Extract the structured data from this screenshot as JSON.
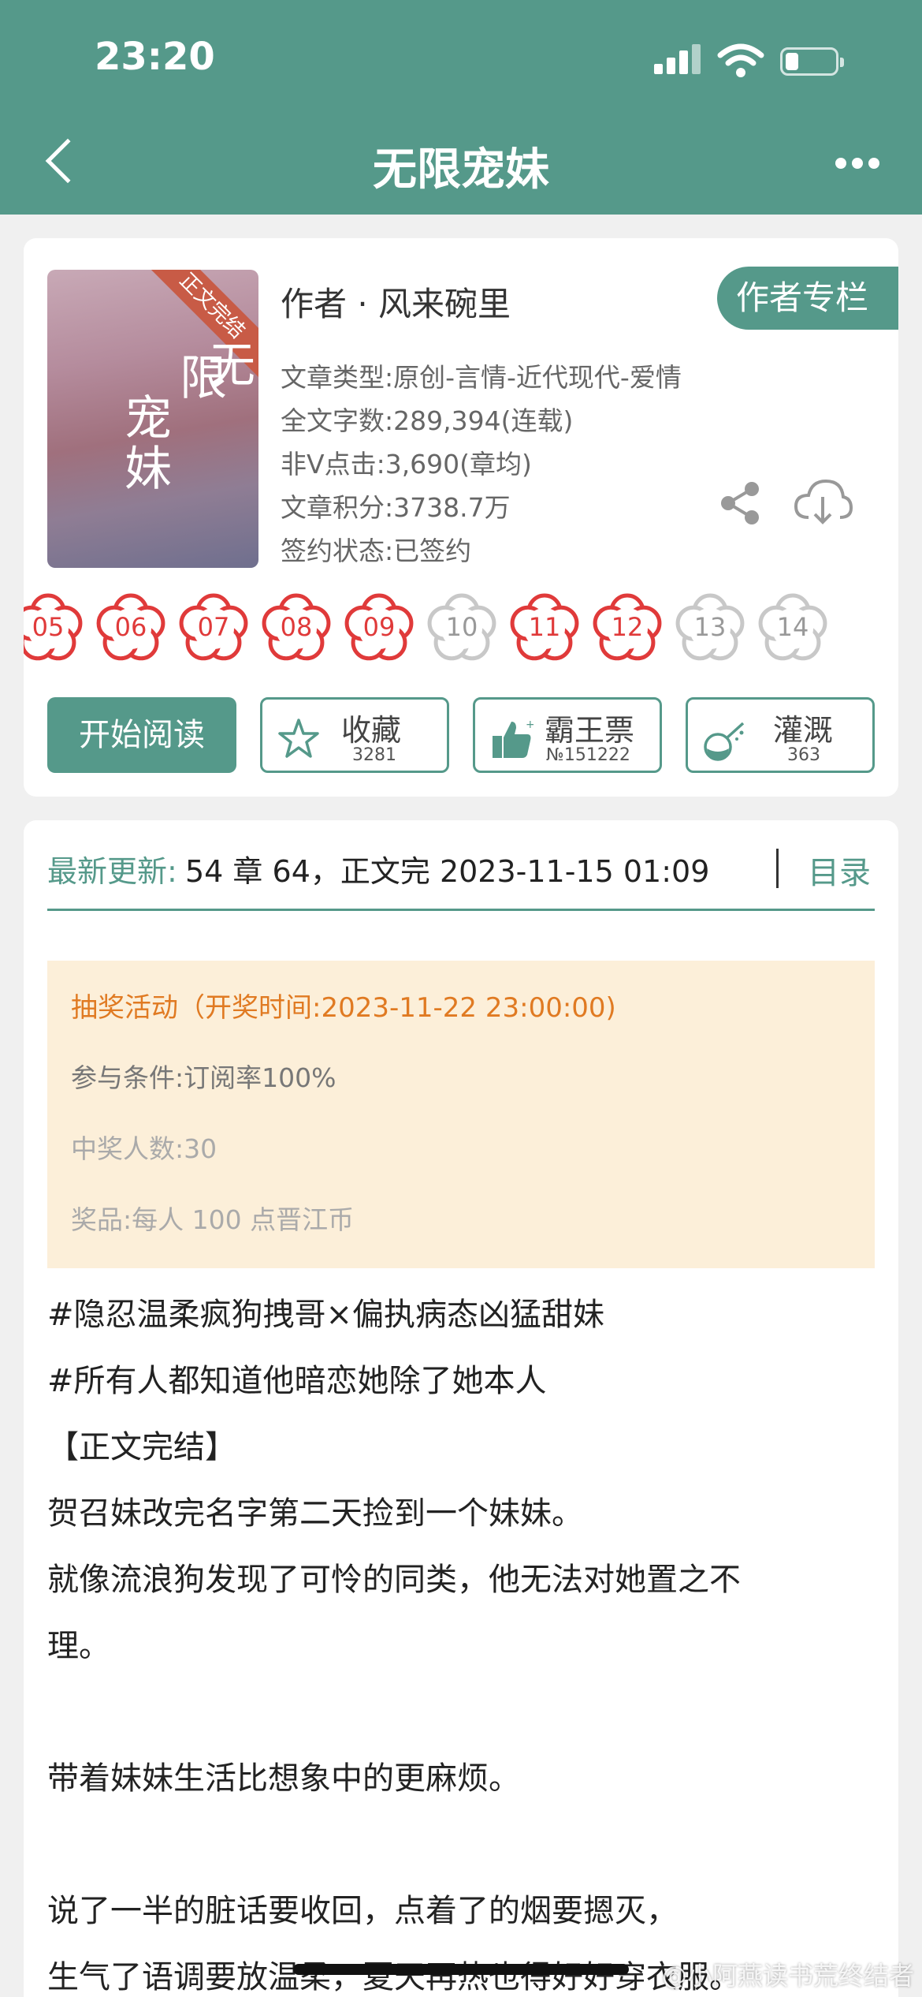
{
  "status_bar": {
    "time": "23:20"
  },
  "nav": {
    "title": "无限宠妹"
  },
  "book": {
    "cover_ribbon": "正文完结",
    "cover_title": [
      "无",
      "限",
      "宠",
      "妹"
    ],
    "author": "作者 · 风来碗里",
    "author_column_label": "作者专栏",
    "info": [
      "文章类型:原创-言情-近代现代-爱情",
      "全文字数:289,394(连载)",
      "非Ⅴ点击:3,690(章均)",
      "文章积分:3738.7万",
      "签约状态:已签约"
    ]
  },
  "chapter_flowers": [
    {
      "num": "05",
      "active": true
    },
    {
      "num": "06",
      "active": true
    },
    {
      "num": "07",
      "active": true
    },
    {
      "num": "08",
      "active": true
    },
    {
      "num": "09",
      "active": true
    },
    {
      "num": "10",
      "active": false
    },
    {
      "num": "11",
      "active": true
    },
    {
      "num": "12",
      "active": true
    },
    {
      "num": "13",
      "active": false
    },
    {
      "num": "14",
      "active": false
    }
  ],
  "actions": {
    "read": "开始阅读",
    "favorite": {
      "label": "收藏",
      "count": "3281"
    },
    "overlord": {
      "label": "霸王票",
      "count": "№151222"
    },
    "irrigate": {
      "label": "灌溉",
      "count": "363"
    }
  },
  "update": {
    "label": "最新更新:",
    "text": "54 章 64，正文完 2023-11-15 01:09",
    "toc": "目录"
  },
  "lottery": {
    "title": "抽奖活动（开奖时间:2023-11-22 23:00:00)",
    "condition": "参与条件:订阅率100%",
    "winners": "中奖人数:30",
    "prize": "奖品:每人 100 点晋江币"
  },
  "description": [
    "#隐忍温柔疯狗拽哥×偏执病态凶猛甜妹",
    "#所有人都知道他暗恋她除了她本人",
    "【正文完结】",
    "贺召妹改完名字第二天捡到一个妹妹。",
    "就像流浪狗发现了可怜的同类，他无法对她置之不",
    "理。",
    "",
    "带着妹妹生活比想象中的更麻烦。",
    "",
    "说了一半的脏话要收回，点着了的烟要摁灭，",
    "生气了语调要放温柔，夏天再热也得好好穿衣服。"
  ],
  "watermark": "@小阿燕读书荒终结者",
  "colors": {
    "accent": "#55998a",
    "flower_red": "#e03a3a",
    "flower_grey": "#c8c8c8",
    "lottery_bg": "#fcefd9",
    "lottery_title": "#e07a22"
  }
}
